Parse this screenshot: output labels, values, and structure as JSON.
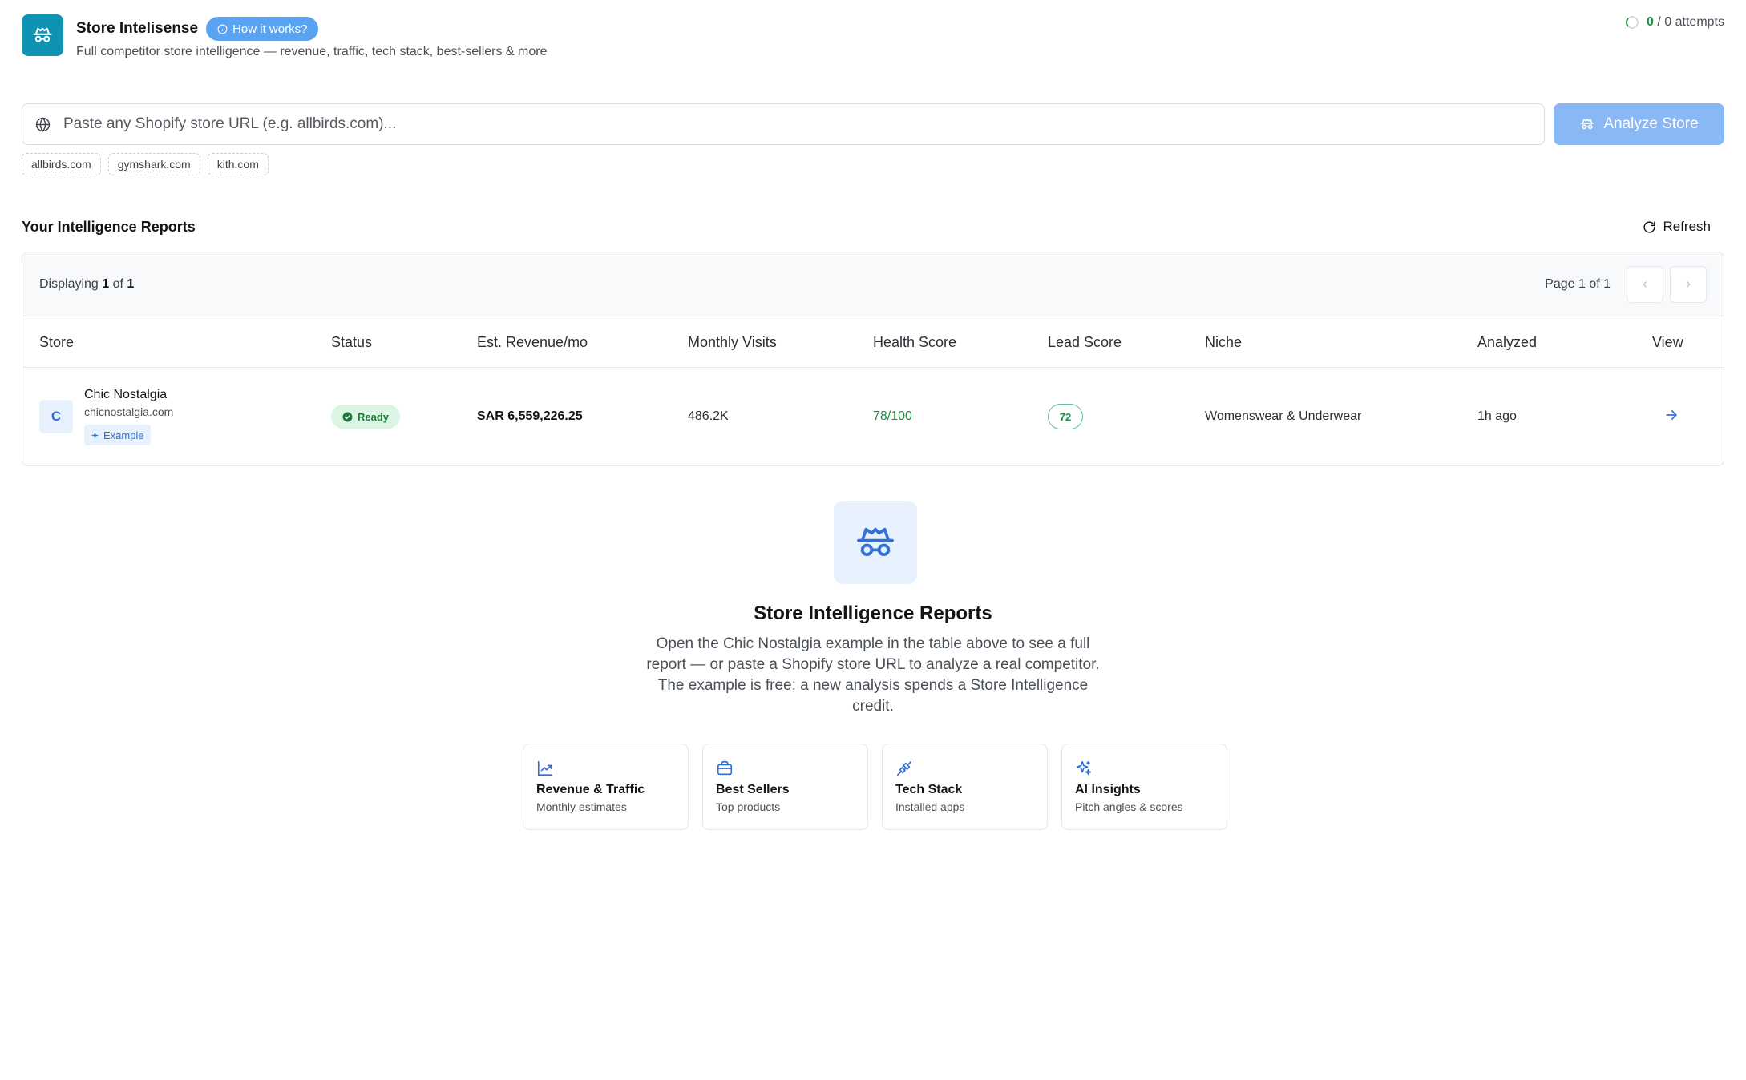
{
  "header": {
    "title": "Store Intelisense",
    "how_label": "How it works?",
    "subtitle": "Full competitor store intelligence — revenue, traffic, tech stack, best-sellers & more",
    "attempts_used": "0",
    "attempts_total": "/ 0 attempts"
  },
  "search": {
    "placeholder": "Paste any Shopify store URL (e.g. allbirds.com)...",
    "value": "",
    "button_label": "Analyze Store",
    "chips": [
      "allbirds.com",
      "gymshark.com",
      "kith.com"
    ]
  },
  "reports": {
    "title": "Your Intelligence Reports",
    "refresh_label": "Refresh",
    "displaying_prefix": "Displaying",
    "displaying_count": "1",
    "displaying_mid": "of",
    "displaying_total": "1",
    "page_label": "Page 1 of 1",
    "columns": {
      "store": "Store",
      "status": "Status",
      "revenue": "Est. Revenue/mo",
      "visits": "Monthly Visits",
      "health": "Health Score",
      "lead": "Lead Score",
      "niche": "Niche",
      "analyzed": "Analyzed",
      "view": "View"
    },
    "rows": [
      {
        "initial": "C",
        "name": "Chic Nostalgia",
        "domain": "chicnostalgia.com",
        "tag": "Example",
        "status": "Ready",
        "revenue": "SAR 6,559,226.25",
        "visits": "486.2K",
        "health": "78/100",
        "lead": "72",
        "niche": "Womenswear & Underwear",
        "analyzed": "1h ago"
      }
    ]
  },
  "empty_state": {
    "title": "Store Intelligence Reports",
    "description": "Open the Chic Nostalgia example in the table above to see a full report — or paste a Shopify store URL to analyze a real competitor. The example is free; a new analysis spends a Store Intelligence credit.",
    "features": [
      {
        "icon": "trending-chart-icon",
        "name": "Revenue & Traffic",
        "desc": "Monthly estimates"
      },
      {
        "icon": "briefcase-icon",
        "name": "Best Sellers",
        "desc": "Top products"
      },
      {
        "icon": "plug-icon",
        "name": "Tech Stack",
        "desc": "Installed apps"
      },
      {
        "icon": "sparkles-icon",
        "name": "AI Insights",
        "desc": "Pitch angles & scores"
      }
    ]
  },
  "colors": {
    "brand": "#0e93b3",
    "accent": "#2f6fd6",
    "success": "#1c8f44",
    "button_disabled": "#8ab8f4"
  }
}
